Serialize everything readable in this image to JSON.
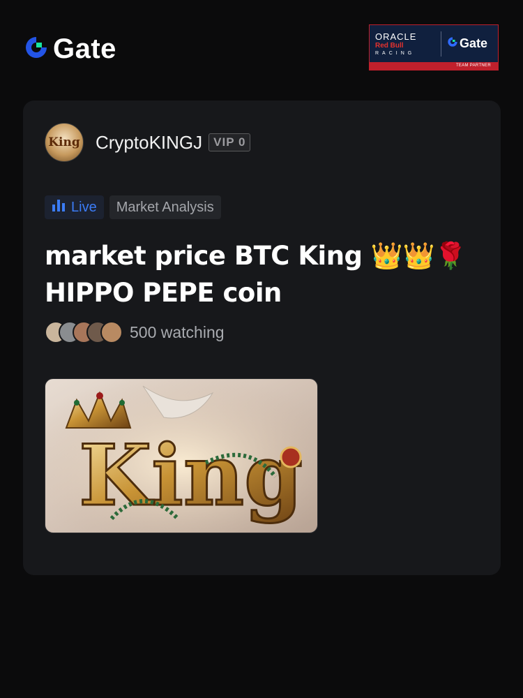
{
  "header": {
    "brand": "Gate",
    "partner": {
      "oracle": "ORACLE",
      "redbull": "Red Bull",
      "racing": "RACING",
      "gate": "Gate",
      "strip": "TEAM PARTNER"
    }
  },
  "post": {
    "author": {
      "avatar_text": "King",
      "name": "CryptoKINGJ",
      "vip": "VIP 0"
    },
    "tags": {
      "live": "Live",
      "category": "Market Analysis"
    },
    "title": "market price BTC King 👑👑🌹 HIPPO PEPE coin",
    "watching": "500 watching",
    "cover": {
      "text": "King"
    }
  },
  "colors": {
    "background": "#0b0b0c",
    "card": "#17181b",
    "accent_blue": "#3b7cf6",
    "gate_blue": "#2354e6",
    "gate_green": "#17e6a1"
  }
}
